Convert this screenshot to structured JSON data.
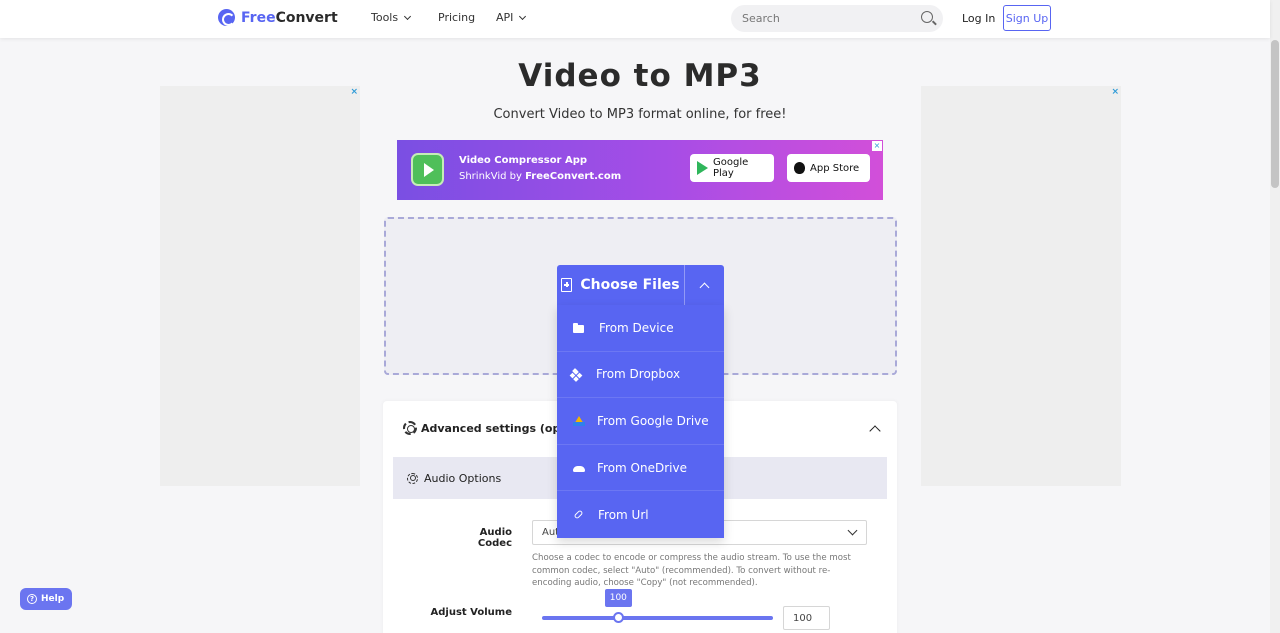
{
  "header": {
    "logo_prefix": "Free",
    "logo_suffix": "Convert",
    "nav": [
      {
        "label": "Tools"
      },
      {
        "label": "Pricing"
      },
      {
        "label": "API"
      }
    ],
    "search_placeholder": "Search",
    "login_label": "Log In",
    "signup_label": "Sign Up"
  },
  "ads": {
    "close_glyph": "×"
  },
  "hero": {
    "title": "Video to MP3",
    "subtitle": "Convert Video to MP3 format online, for free!"
  },
  "banner": {
    "line1": "Video Compressor App",
    "line2_prefix": "ShrinkVid by ",
    "line2_bold": "FreeConvert.com",
    "google_play": "Google Play",
    "app_store": "App Store"
  },
  "upload": {
    "choose_label": "Choose Files",
    "menu": [
      {
        "label": "From Device",
        "icon": "folder-icon"
      },
      {
        "label": "From Dropbox",
        "icon": "dropbox-icon"
      },
      {
        "label": "From Google Drive",
        "icon": "gdrive-icon"
      },
      {
        "label": "From OneDrive",
        "icon": "onedrive-icon"
      },
      {
        "label": "From Url",
        "icon": "link-icon"
      }
    ]
  },
  "settings": {
    "advanced_label": "Advanced settings (optiona",
    "audio_options_label": "Audio Options",
    "codec_label": "Audio Codec",
    "codec_value": "Aut",
    "codec_help": "Choose a codec to encode or compress the audio stream. To use the most common codec, select \"Auto\" (recommended). To convert without re-encoding audio, choose \"Copy\" (not recommended).",
    "volume_label": "Adjust Volume",
    "volume_tip": "100",
    "volume_value": "100",
    "volume_fraction": 0.33
  },
  "help": {
    "label": "Help"
  },
  "colors": {
    "brand": "#5865f2",
    "slider": "#6b75f0"
  }
}
